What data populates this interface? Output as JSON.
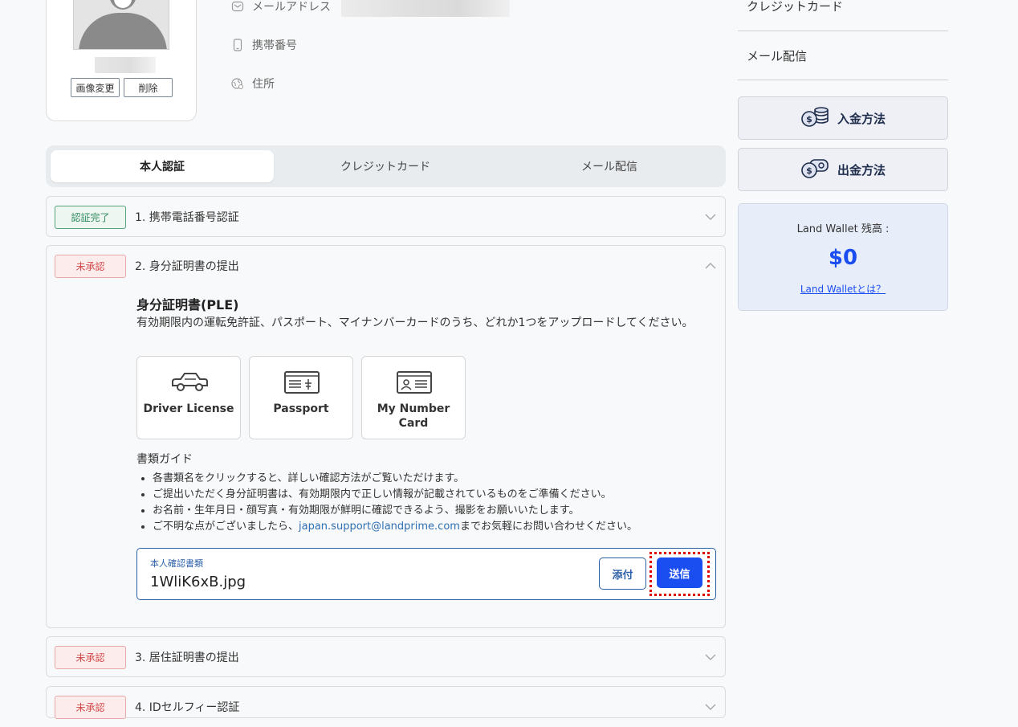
{
  "profile": {
    "change_image_label": "画像変更",
    "delete_label": "削除",
    "email_label": "メールアドレス",
    "phone_label": "携帯番号",
    "address_label": "住所"
  },
  "tabs": [
    {
      "label": "本人認証",
      "active": true
    },
    {
      "label": "クレジットカード",
      "active": false
    },
    {
      "label": "メール配信",
      "active": false
    }
  ],
  "verification": [
    {
      "badge": "認証完了",
      "status": "done",
      "title": "1. 携帯電話番号認証"
    },
    {
      "badge": "未承認",
      "status": "pending",
      "title": "2. 身分証明書の提出"
    },
    {
      "badge": "未承認",
      "status": "pending",
      "title": "3. 居住証明書の提出"
    },
    {
      "badge": "未承認",
      "status": "pending",
      "title": "4. IDセルフィー認証"
    }
  ],
  "id_section": {
    "title": "身分証明書(PLE)",
    "description": "有効期限内の運転免許証、パスポート、マイナンバーカードのうち、どれか1つをアップロードしてください。",
    "doc_types": [
      {
        "label_line1": "Driver License",
        "label_line2": "",
        "icon": "car-icon"
      },
      {
        "label_line1": "Passport",
        "label_line2": "",
        "icon": "passport-icon"
      },
      {
        "label_line1": "My Number",
        "label_line2": "Card",
        "icon": "id-card-icon"
      }
    ],
    "guide_title": "書類ガイド",
    "guide_items": [
      "各書類名をクリックすると、詳しい確認方法がご覧いただけます。",
      "ご提出いただく身分証明書は、有効期限内で正しい情報が記載されているものをご準備ください。",
      "お名前・生年月日・顔写真・有効期限が鮮明に確認できるよう、撮影をお願いいたします。"
    ],
    "guide_last_prefix": "ご不明な点がございましたら、",
    "guide_last_email": "japan.support@landprime.com",
    "guide_last_suffix": "までお気軽にお問い合わせください。",
    "upload_label": "本人確認書類",
    "upload_file": "1WliK6xB.jpg",
    "attach_label": "添付",
    "send_label": "送信"
  },
  "sidebar": {
    "credit_card": "クレジットカード",
    "mail_delivery": "メール配信",
    "deposit_label": "入金方法",
    "withdraw_label": "出金方法",
    "wallet_title": "Land Wallet 残高 :",
    "wallet_amount": "$0",
    "wallet_link": "Land Walletとは？"
  },
  "colors": {
    "accent": "#1b4ef0",
    "done_badge": "#2f8a5e",
    "pending_badge": "#d14a4a",
    "highlight": "#e00000"
  }
}
